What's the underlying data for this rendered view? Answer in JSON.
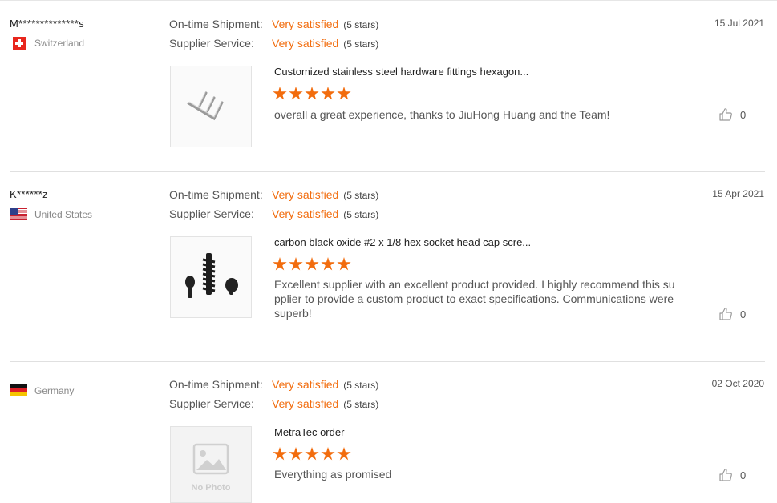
{
  "colors": {
    "accent": "#f26c0d",
    "divider": "#e0e0e0"
  },
  "labels": {
    "shipment": "On-time Shipment:",
    "service": "Supplier Service:"
  },
  "reviews": [
    {
      "user": "M**************s",
      "country": "Switzerland",
      "flag": "switzerland-flag",
      "shipment": {
        "value": "Very satisfied",
        "stars": "(5 stars)"
      },
      "service": {
        "value": "Very satisfied",
        "stars": "(5 stars)"
      },
      "date": "15 Jul 2021",
      "product_title": "Customized stainless steel hardware fittings hexagon...",
      "rating": 5,
      "comment": "overall a great experience, thanks to JiuHong Huang and the Team!",
      "likes": "0"
    },
    {
      "user": "K******z",
      "country": "United States",
      "flag": "united-states-flag",
      "shipment": {
        "value": "Very satisfied",
        "stars": "(5 stars)"
      },
      "service": {
        "value": "Very satisfied",
        "stars": "(5 stars)"
      },
      "date": "15 Apr 2021",
      "product_title": "carbon black oxide #2 x 1/8 hex socket head cap scre...",
      "rating": 5,
      "comment": "Excellent supplier with an excellent product provided.  I highly recommend this su pplier to provide a custom product to exact specifications.  Communications were superb!",
      "likes": "0"
    },
    {
      "user": "",
      "country": "Germany",
      "flag": "germany-flag",
      "shipment": {
        "value": "Very satisfied",
        "stars": "(5 stars)"
      },
      "service": {
        "value": "Very satisfied",
        "stars": "(5 stars)"
      },
      "date": "02 Oct 2020",
      "product_title": "MetraTec order",
      "rating": 5,
      "comment": "Everything as promised",
      "likes": "0",
      "no_photo_text": "No Photo"
    }
  ]
}
